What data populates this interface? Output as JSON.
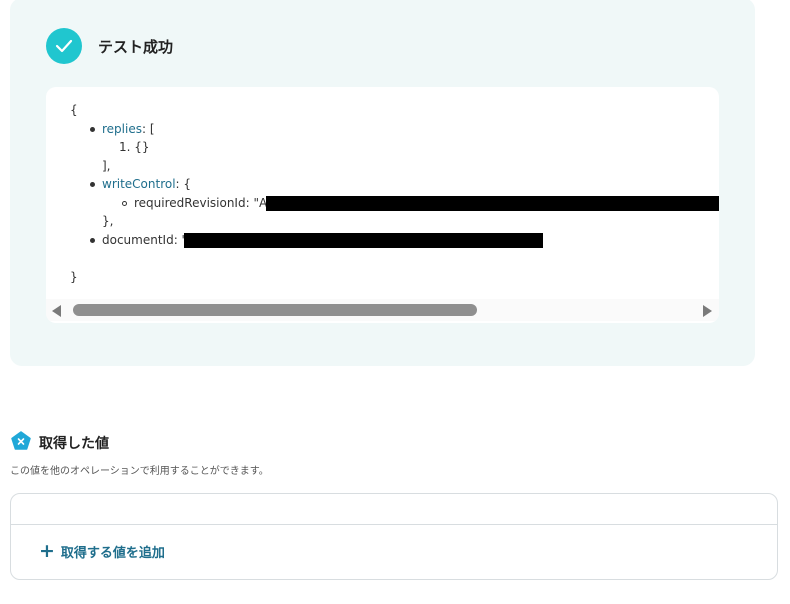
{
  "success": {
    "title": "テスト成功",
    "accent_color": "#20c6cf"
  },
  "code": {
    "open_brace": "{",
    "close_brace": "}",
    "replies_key": "replies",
    "replies_suffix": ": [",
    "replies_item": "1. {}",
    "replies_close": "],",
    "writecontrol_key": "writeControl",
    "writecontrol_suffix": ": {",
    "revision_text": "requiredRevisionId: \"A",
    "writecontrol_close": "},",
    "documentid_text": "documentId: \"",
    "key_color": "#1f6e8c"
  },
  "values": {
    "title": "取得した値",
    "description": "この値を他のオペレーションで利用することができます。",
    "add_label": "取得する値を追加",
    "icon": "x-pentagon-icon"
  }
}
